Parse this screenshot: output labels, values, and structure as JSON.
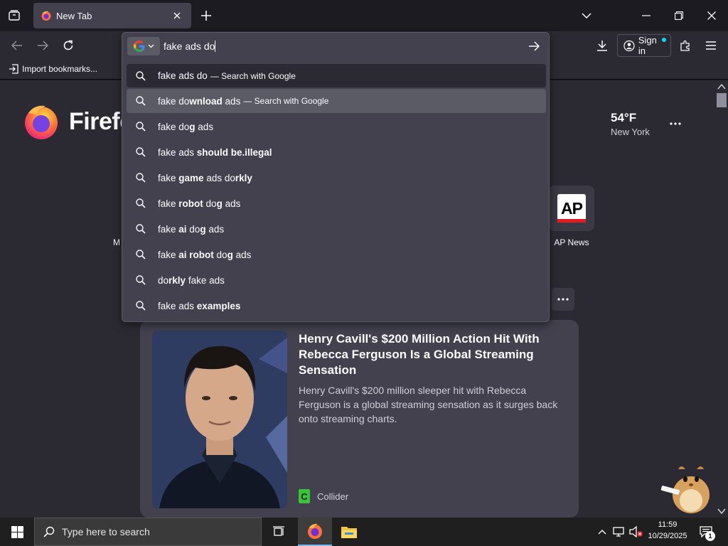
{
  "browser": {
    "tab": {
      "title": "New Tab"
    },
    "bookmarks_bar": {
      "import_label": "Import bookmarks..."
    },
    "signin_label": "Sign in"
  },
  "urlbar": {
    "typed": "fake ads do",
    "engine": "Google",
    "suggestions": [
      {
        "parts": [
          [
            "fake ads do",
            false
          ]
        ],
        "suffix": "— Search with Google"
      },
      {
        "parts": [
          [
            "fake do",
            false
          ],
          [
            "wnload",
            true
          ],
          [
            " ads",
            false
          ]
        ],
        "suffix": "— Search with Google"
      },
      {
        "parts": [
          [
            "fake do",
            false
          ],
          [
            "g",
            true
          ],
          [
            " ads",
            false
          ]
        ],
        "suffix": ""
      },
      {
        "parts": [
          [
            "fake ads ",
            false
          ],
          [
            "should be.illegal",
            true
          ]
        ],
        "suffix": ""
      },
      {
        "parts": [
          [
            "fake ",
            false
          ],
          [
            "game",
            true
          ],
          [
            " ads do",
            false
          ],
          [
            "rkly",
            true
          ]
        ],
        "suffix": ""
      },
      {
        "parts": [
          [
            "fake ",
            false
          ],
          [
            "robot",
            true
          ],
          [
            " do",
            false
          ],
          [
            "g",
            true
          ],
          [
            " ads",
            false
          ]
        ],
        "suffix": ""
      },
      {
        "parts": [
          [
            "fake ",
            false
          ],
          [
            "ai",
            true
          ],
          [
            " do",
            false
          ],
          [
            "g",
            true
          ],
          [
            " ads",
            false
          ]
        ],
        "suffix": ""
      },
      {
        "parts": [
          [
            "fake ",
            false
          ],
          [
            "ai robot",
            true
          ],
          [
            " do",
            false
          ],
          [
            "g",
            true
          ],
          [
            " ads",
            false
          ]
        ],
        "suffix": ""
      },
      {
        "parts": [
          [
            "do",
            false
          ],
          [
            "rkly",
            true
          ],
          [
            " fake ads",
            false
          ]
        ],
        "suffix": ""
      },
      {
        "parts": [
          [
            "fake ads ",
            false
          ],
          [
            "examples",
            true
          ]
        ],
        "suffix": ""
      }
    ]
  },
  "newtab": {
    "brand": "Firefo",
    "weather": {
      "temp": "54°F",
      "city": "New York"
    },
    "shortcut_ap": {
      "logo": "AP",
      "label": "AP News"
    },
    "partial_shortcut_label": "M",
    "story": {
      "headline": "Henry Cavill's $200 Million Action Hit With Rebecca Ferguson Is a Global Streaming Sensation",
      "excerpt": "Henry Cavill's $200 million sleeper hit with Rebecca Ferguson is a global streaming sensation as it surges back onto streaming charts.",
      "source_badge": "C",
      "source": "Collider"
    }
  },
  "taskbar": {
    "search_placeholder": "Type here to search",
    "time": "11:59",
    "date": "10/29/2025",
    "notification_count": "1"
  },
  "colors": {
    "accent": "#00ddff",
    "panel": "#42414d",
    "chrome": "#2b2a33",
    "ap_red": "#e31b23",
    "collider_green": "#3ac33a"
  }
}
